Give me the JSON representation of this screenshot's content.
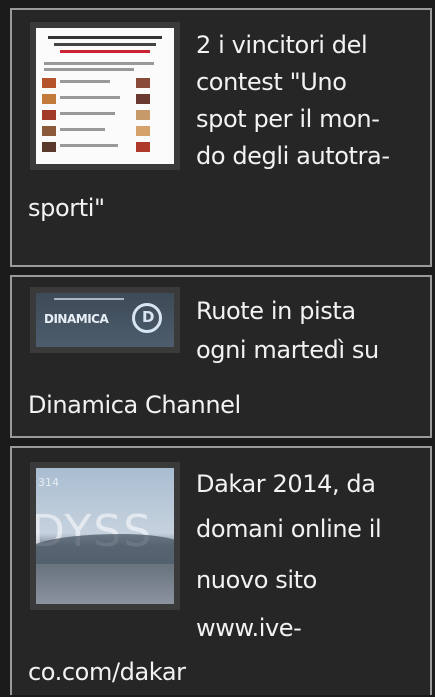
{
  "articles": [
    {
      "title_lines": [
        "2 i vincitori del",
        "contest \"Uno",
        "spot per il mon-",
        "do degli autotra-",
        "sporti\""
      ],
      "thumb_icon": "newspaper-screenshot-icon"
    },
    {
      "title_lines": [
        "Ruote in pista",
        "ogni martedì su",
        "Dinamica Channel"
      ],
      "thumb_icon": "dinamica-logo-icon",
      "thumb_text": {
        "wordmark": "DINAMICA",
        "letter": "D"
      }
    },
    {
      "title_lines": [
        "Dakar 2014, da",
        "domani online il",
        "nuovo sito",
        "www.ive-",
        "co.com/dakar"
      ],
      "thumb_icon": "dakar-desert-image",
      "thumb_text": {
        "big": "DYSS",
        "small": "314"
      }
    }
  ],
  "colors": {
    "background": "#1b1b1b",
    "card": "#262626",
    "border": "#9a9a9a",
    "text": "#f2f2f2"
  }
}
